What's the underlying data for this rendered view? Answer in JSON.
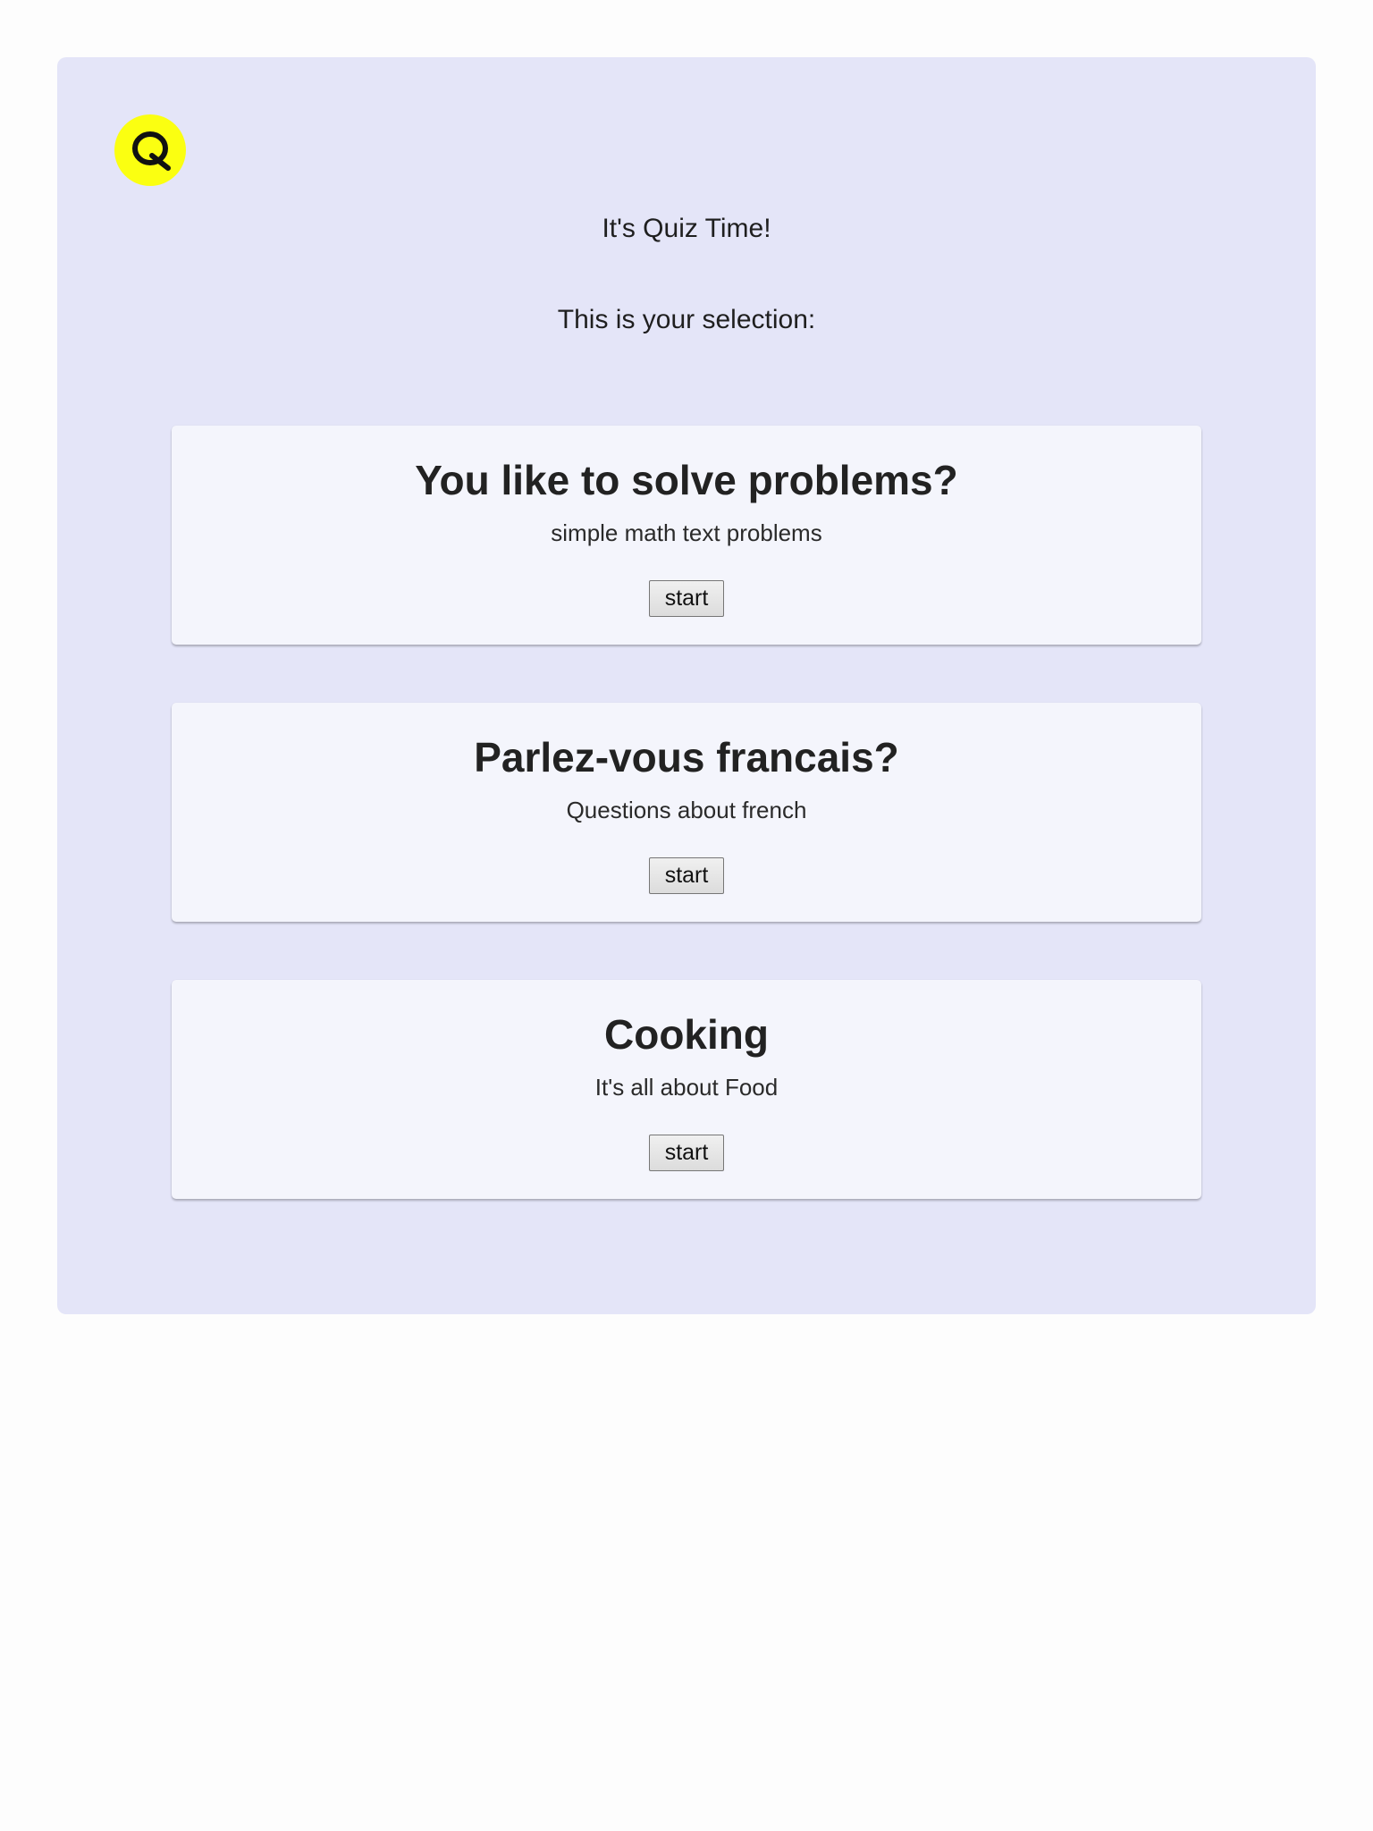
{
  "logo": {
    "icon": "quiz-q-logo-icon",
    "letter": "Q",
    "color": "#fbff11"
  },
  "header": {
    "title": "It's Quiz Time!",
    "subtitle": "This is your selection:"
  },
  "quizzes": [
    {
      "title": "You like to solve problems?",
      "description": "simple math text problems",
      "button_label": "start"
    },
    {
      "title": "Parlez-vous francais?",
      "description": "Questions about french",
      "button_label": "start"
    },
    {
      "title": "Cooking",
      "description": "It's all about Food",
      "button_label": "start"
    }
  ],
  "colors": {
    "panel_background": "#e4e5f8",
    "card_background": "#f4f5fc",
    "page_background": "#fdfdfd"
  }
}
